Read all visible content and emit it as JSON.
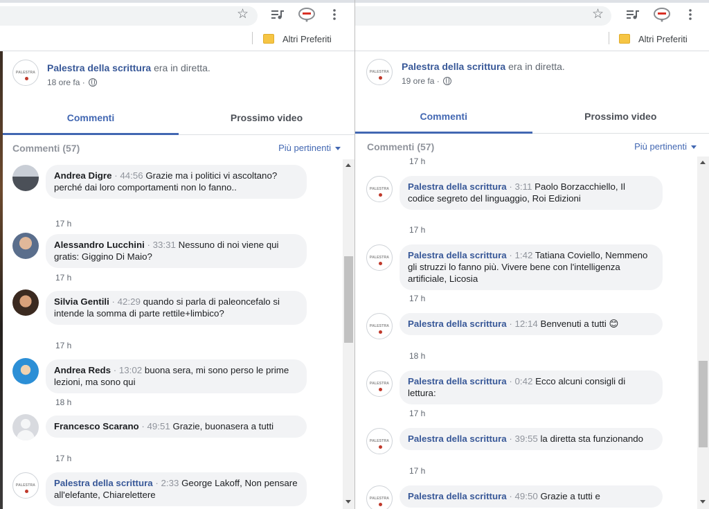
{
  "bookmarks": {
    "folder_label": "Altri Preferiti"
  },
  "left": {
    "post": {
      "page_name": "Palestra della scrittura",
      "suffix": " era in diretta.",
      "time": "18 ore fa ·"
    },
    "tabs": {
      "comments": "Commenti",
      "next_video": "Prossimo video"
    },
    "comments_count": "Commenti (57)",
    "sort_label": "Più pertinenti",
    "comments": [
      {
        "author": "Andrea Digre",
        "ts": "44:56",
        "text": "Grazie ma i politici vi ascoltano? perché dai loro comportamenti non lo fanno..",
        "ago": "17 h"
      },
      {
        "author": "Alessandro Lucchini",
        "ts": "33:31",
        "text": "Nessuno di noi viene qui gratis: Giggino Di Maio?",
        "ago": "17 h"
      },
      {
        "author": "Silvia Gentili",
        "ts": "42:29",
        "text": "quando si parla di paleoncefalo si intende la somma di parte rettile+limbico?",
        "ago": "17 h"
      },
      {
        "author": "Andrea Reds",
        "ts": "13:02",
        "text": "buona sera, mi sono perso le prime lezioni, ma sono qui",
        "ago": "18 h"
      },
      {
        "author": "Francesco Scarano",
        "ts": "49:51",
        "text": "Grazie, buonasera a tutti",
        "ago": "17 h"
      },
      {
        "author": "Palestra della scrittura",
        "ts": "2:33",
        "text": "George Lakoff, Non pensare all'elefante, Chiarelettere",
        "ago": ""
      }
    ]
  },
  "right": {
    "post": {
      "page_name": "Palestra della scrittura",
      "suffix": " era in diretta.",
      "time": "19 ore fa ·"
    },
    "tabs": {
      "comments": "Commenti",
      "next_video": "Prossimo video"
    },
    "comments_count": "Commenti (57)",
    "sort_label": "Più pertinenti",
    "top_ago": "17 h",
    "comments": [
      {
        "author": "Palestra della scrittura",
        "ts": "3:11",
        "text": "Paolo Borzacchiello, Il codice segreto del linguaggio, Roi Edizioni",
        "ago": "17 h"
      },
      {
        "author": "Palestra della scrittura",
        "ts": "1:42",
        "text": "Tatiana Coviello, Nemmeno gli struzzi lo fanno più. Vivere bene con l'intelligenza artificiale, Licosia",
        "ago": "17 h"
      },
      {
        "author": "Palestra della scrittura",
        "ts": "12:14",
        "text": "Benvenuti a tutti 😊",
        "ago": "18 h"
      },
      {
        "author": "Palestra della scrittura",
        "ts": "0:42",
        "text": "Ecco alcuni consigli di lettura:",
        "ago": "17 h"
      },
      {
        "author": "Palestra della scrittura",
        "ts": "39:55",
        "text": "la diretta sta funzionando",
        "ago": "17 h"
      },
      {
        "author": "Palestra della scrittura",
        "ts": "49:50",
        "text": "Grazie a tutti e",
        "ago": ""
      }
    ]
  },
  "icons": {
    "star": "bookmark-star-icon",
    "playlist": "media-playlist-icon",
    "extension": "extension-icon",
    "menu": "kebab-menu-icon",
    "folder": "folder-icon",
    "globe": "globe-icon"
  },
  "colors": {
    "link_blue": "#385898",
    "tab_blue": "#4267b2",
    "bubble_bg": "#f2f3f5",
    "meta_gray": "#90949c"
  }
}
